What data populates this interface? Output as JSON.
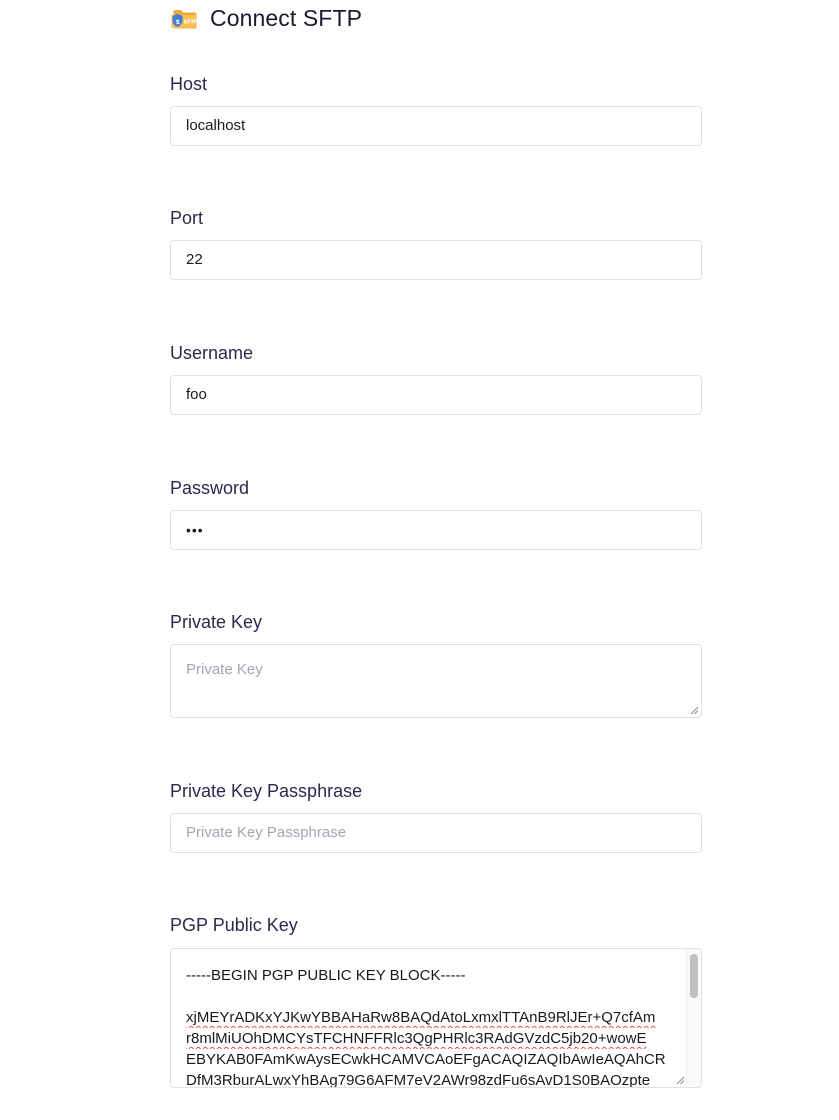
{
  "header": {
    "title": "Connect SFTP",
    "logo_icon": "sftp-folder-shield-icon",
    "logo_text": "SFTP"
  },
  "fields": {
    "host": {
      "label": "Host",
      "value": "localhost"
    },
    "port": {
      "label": "Port",
      "value": "22"
    },
    "username": {
      "label": "Username",
      "value": "foo"
    },
    "password": {
      "label": "Password",
      "value": "•••"
    },
    "private_key": {
      "label": "Private Key",
      "placeholder": "Private Key",
      "value": ""
    },
    "private_key_passphrase": {
      "label": "Private Key Passphrase",
      "placeholder": "Private Key Passphrase",
      "value": ""
    },
    "pgp_public_key": {
      "label": "PGP Public Key",
      "lines": [
        "-----BEGIN PGP PUBLIC KEY BLOCK-----",
        "",
        "xjMEYrADKxYJKwYBBAHaRw8BAQdAtoLxmxlTTAnB9RlJEr+Q7cfAm",
        "r8mlMiUOhDMCYsTFCHNFFRlc3QgPHRlc3RAdGVzdC5jb20+wowE",
        "EBYKAB0FAmKwAysECwkHCAMVCAoEFgACAQIZAQIbAwIeAQAhCR",
        "DfM3RburALwxYhBAg79G6AFM7eV2AWr98zdFu6sAvD1S0BAOzpte"
      ]
    }
  },
  "colors": {
    "label": "#2b2a4c",
    "input_border": "#dfe1e6",
    "placeholder": "#a3a6b1",
    "logo_folder": "#f2a93b",
    "logo_shield": "#3f7fd6"
  }
}
